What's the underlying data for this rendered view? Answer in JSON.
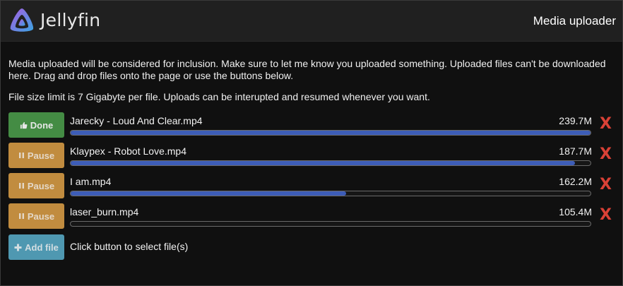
{
  "app": {
    "brand": "Jellyfin",
    "title": "Media uploader"
  },
  "info": {
    "intro": "Media uploaded will be considered for inclusion. Make sure to let me know you uploaded something. Uploaded files can't be downloaded here. Drag and drop files onto the page or use the buttons below.",
    "limit": "File size limit is 7 Gigabyte per file. Uploads can be interupted and resumed whenever you want."
  },
  "uploads": [
    {
      "button_label": "Done",
      "button_state": "done",
      "file_name": "Jarecky - Loud And Clear.mp4",
      "size": "239.7M",
      "progress_percent": 100,
      "remove_label": "X"
    },
    {
      "button_label": "Pause",
      "button_state": "pause",
      "file_name": "Klaypex - Robot Love.mp4",
      "size": "187.7M",
      "progress_percent": 97,
      "remove_label": "X"
    },
    {
      "button_label": "Pause",
      "button_state": "pause",
      "file_name": "I am.mp4",
      "size": "162.2M",
      "progress_percent": 53,
      "remove_label": "X"
    },
    {
      "button_label": "Pause",
      "button_state": "pause",
      "file_name": "laser_burn.mp4",
      "size": "105.4M",
      "progress_percent": 0,
      "remove_label": "X"
    }
  ],
  "add": {
    "button_label": "Add file",
    "hint": "Click button to select file(s)"
  },
  "colors": {
    "done": "#4a9a4a",
    "pause": "#d59a45",
    "add": "#56a7c3",
    "progress": "#3d5db7",
    "remove": "#d94136"
  },
  "icons": {
    "done": "thumbs-up-icon",
    "pause": "pause-icon",
    "add": "plus-icon",
    "remove": "close-icon"
  }
}
